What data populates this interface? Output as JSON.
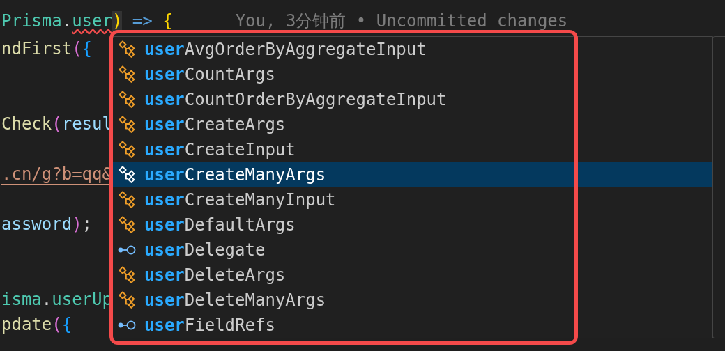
{
  "code_lines": [
    {
      "kind": "tight",
      "tokens": [
        {
          "kind": "type",
          "text": "Prisma"
        },
        {
          "kind": "plain",
          "text": "."
        },
        {
          "kind": "type-error",
          "text": "user"
        },
        {
          "kind": "bracket-cursor",
          "text": ")"
        },
        {
          "kind": "keyword",
          "text": " => "
        },
        {
          "kind": "bracket-gold",
          "text": "{"
        }
      ],
      "blame": "You, 3分钟前 • Uncommitted changes"
    },
    {
      "kind": "tight",
      "tokens": [
        {
          "kind": "function",
          "text": "ndFirst"
        },
        {
          "kind": "bracket-pink",
          "text": "("
        },
        {
          "kind": "bracket-blue",
          "text": "{"
        }
      ]
    },
    {
      "kind": "wide",
      "tokens": [
        {
          "kind": "function",
          "text": "Check"
        },
        {
          "kind": "bracket-pink",
          "text": "("
        },
        {
          "kind": "variable",
          "text": "resul"
        }
      ]
    },
    {
      "kind": "spaced",
      "tokens": [
        {
          "kind": "link",
          "text": ".cn/g?b=qq&"
        }
      ]
    },
    {
      "kind": "spaced",
      "tokens": [
        {
          "kind": "variable",
          "text": "assword"
        },
        {
          "kind": "bracket-pink",
          "text": ")"
        },
        {
          "kind": "plain",
          "text": ";"
        }
      ]
    },
    {
      "kind": "wide",
      "tokens": [
        {
          "kind": "type",
          "text": "isma"
        },
        {
          "kind": "plain",
          "text": "."
        },
        {
          "kind": "type",
          "text": "userUp"
        }
      ]
    },
    {
      "kind": "tight",
      "tokens": [
        {
          "kind": "function",
          "text": "pdate"
        },
        {
          "kind": "bracket-pink",
          "text": "("
        },
        {
          "kind": "bracket-blue",
          "text": "{"
        }
      ]
    }
  ],
  "suggestions": [
    {
      "kind": "type",
      "label": "**user**AvgOrderByAggregateInput",
      "selected": false
    },
    {
      "kind": "type",
      "label": "**user**CountArgs",
      "selected": false
    },
    {
      "kind": "type",
      "label": "**user**CountOrderByAggregateInput",
      "selected": false
    },
    {
      "kind": "type",
      "label": "**user**CreateArgs",
      "selected": false
    },
    {
      "kind": "type",
      "label": "**user**CreateInput",
      "selected": false
    },
    {
      "kind": "type",
      "label": "**user**CreateManyArgs",
      "selected": true
    },
    {
      "kind": "type",
      "label": "**user**CreateManyInput",
      "selected": false
    },
    {
      "kind": "type",
      "label": "**user**DefaultArgs",
      "selected": false
    },
    {
      "kind": "field",
      "label": "**user**Delegate",
      "selected": false
    },
    {
      "kind": "type",
      "label": "**user**DeleteArgs",
      "selected": false
    },
    {
      "kind": "type",
      "label": "**user**DeleteManyArgs",
      "selected": false
    },
    {
      "kind": "field",
      "label": "**user**FieldRefs",
      "selected": false
    }
  ]
}
